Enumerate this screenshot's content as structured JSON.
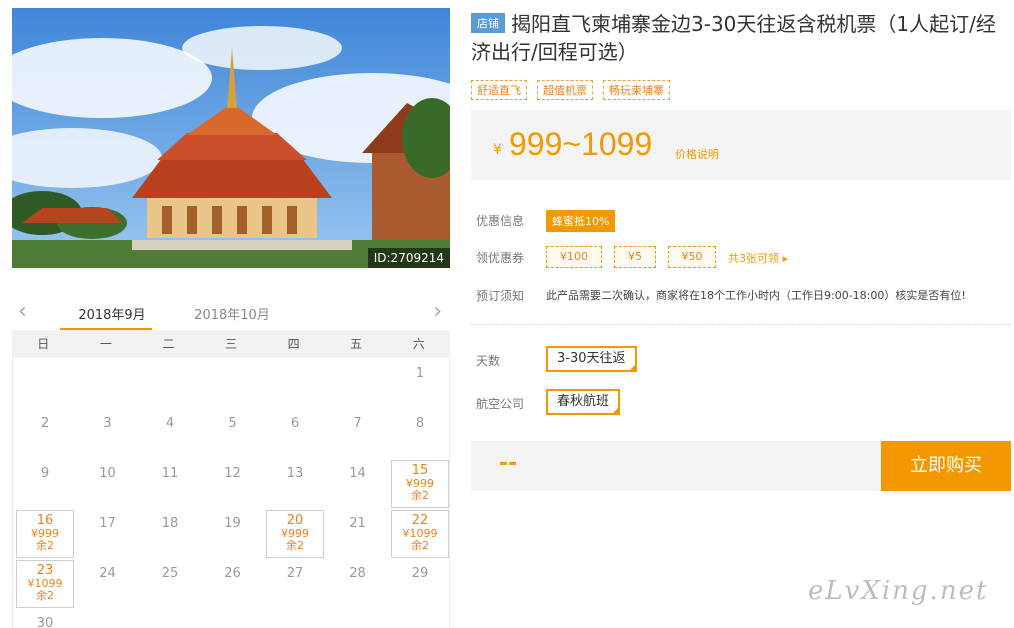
{
  "photo": {
    "id_label": "ID:2709214"
  },
  "calendar": {
    "prev_arrow": "‹",
    "next_arrow": "›",
    "months": [
      "2018年9月",
      "2018年10月"
    ],
    "weekdays": [
      "日",
      "一",
      "二",
      "三",
      "四",
      "五",
      "六"
    ],
    "days": [
      {
        "d": "1",
        "row": 0,
        "col": 6
      },
      {
        "d": "2",
        "row": 1,
        "col": 0
      },
      {
        "d": "3",
        "row": 1,
        "col": 1
      },
      {
        "d": "4",
        "row": 1,
        "col": 2
      },
      {
        "d": "5",
        "row": 1,
        "col": 3
      },
      {
        "d": "6",
        "row": 1,
        "col": 4
      },
      {
        "d": "7",
        "row": 1,
        "col": 5
      },
      {
        "d": "8",
        "row": 1,
        "col": 6
      },
      {
        "d": "9",
        "row": 2,
        "col": 0
      },
      {
        "d": "10",
        "row": 2,
        "col": 1
      },
      {
        "d": "11",
        "row": 2,
        "col": 2
      },
      {
        "d": "12",
        "row": 2,
        "col": 3
      },
      {
        "d": "13",
        "row": 2,
        "col": 4
      },
      {
        "d": "14",
        "row": 2,
        "col": 5
      },
      {
        "d": "15",
        "row": 2,
        "col": 6,
        "price": "¥999",
        "remain": "余2"
      },
      {
        "d": "16",
        "row": 3,
        "col": 0,
        "price": "¥999",
        "remain": "余2"
      },
      {
        "d": "17",
        "row": 3,
        "col": 1
      },
      {
        "d": "18",
        "row": 3,
        "col": 2
      },
      {
        "d": "19",
        "row": 3,
        "col": 3
      },
      {
        "d": "20",
        "row": 3,
        "col": 4,
        "price": "¥999",
        "remain": "余2"
      },
      {
        "d": "21",
        "row": 3,
        "col": 5
      },
      {
        "d": "22",
        "row": 3,
        "col": 6,
        "price": "¥1099",
        "remain": "余2"
      },
      {
        "d": "23",
        "row": 4,
        "col": 0,
        "price": "¥1099",
        "remain": "余2"
      },
      {
        "d": "24",
        "row": 4,
        "col": 1
      },
      {
        "d": "25",
        "row": 4,
        "col": 2
      },
      {
        "d": "26",
        "row": 4,
        "col": 3
      },
      {
        "d": "27",
        "row": 4,
        "col": 4
      },
      {
        "d": "28",
        "row": 4,
        "col": 5
      },
      {
        "d": "29",
        "row": 4,
        "col": 6
      },
      {
        "d": "30",
        "row": 5,
        "col": 0
      }
    ]
  },
  "product": {
    "shop_badge": "店铺",
    "title": "揭阳直飞柬埔寨金边3-30天往返含税机票（1人起订/经济出行/回程可选）",
    "tags": [
      "舒适直飞",
      "超值机票",
      "畅玩柬埔寨"
    ],
    "price_symbol": "¥",
    "price_range": "999~1099",
    "price_note": "价格说明"
  },
  "info": {
    "promo_label": "优惠信息",
    "promo_badge": "蜂蜜抵10%",
    "coupon_label": "领优惠券",
    "coupons": [
      "¥100",
      "¥5",
      "¥50"
    ],
    "coupon_more": "共3张可领 ▸",
    "notice_label": "预订须知",
    "notice_text": "此产品需要二次确认，商家将在18个工作小时内（工作日9:00-18:00）核实是否有位!"
  },
  "options": {
    "days_label": "天数",
    "days_value": "3-30天往返",
    "airline_label": "航空公司",
    "airline_value": "春秋航班"
  },
  "buy": {
    "total": "--",
    "button": "立即购买"
  },
  "watermark": "eLvXing.net",
  "colors": {
    "accent": "#f39800",
    "badge_blue": "#5b9bd5"
  }
}
